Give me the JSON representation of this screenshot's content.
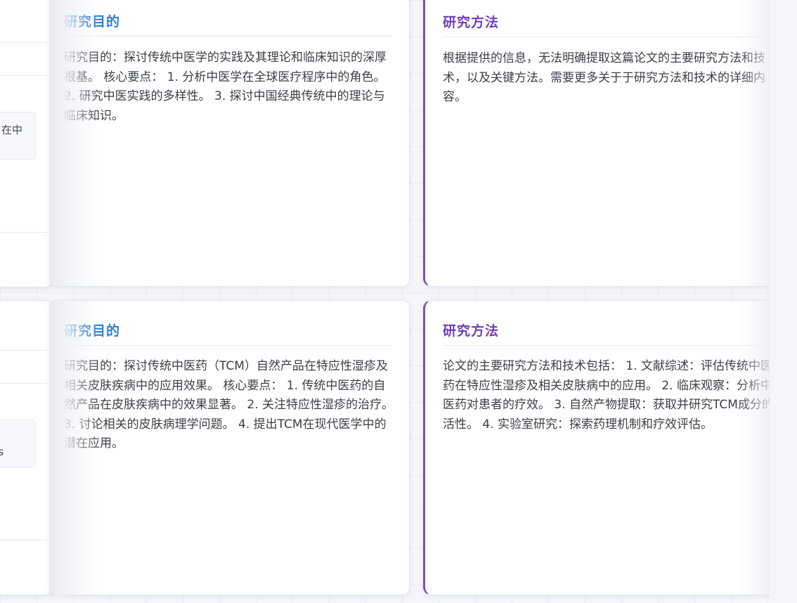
{
  "rows": [
    {
      "left_partial": {
        "chip_text": "在中"
      },
      "purpose": {
        "title": "研究目的",
        "body": "研究目的：探讨传统中医学的实践及其理论和临床知识的深厚根基。 核心要点： 1. 分析中医学在全球医疗程序中的角色。 2. 研究中医实践的多样性。 3. 探讨中国经典传统中的理论与临床知识。"
      },
      "method": {
        "title": "研究方法",
        "body": "根据提供的信息，无法明确提取这篇论文的主要研究方法和技术，以及关键方法。需要更多关于于研究方法和技术的详细内容。"
      }
    },
    {
      "left_partial": {
        "chip_text": "ers"
      },
      "purpose": {
        "title": "研究目的",
        "body": "研究目的：探讨传统中医药（TCM）自然产品在特应性湿疹及相关皮肤疾病中的应用效果。 核心要点： 1. 传统中医药的自然产品在皮肤疾病中的效果显著。 2. 关注特应性湿疹的治疗。 3. 讨论相关的皮肤病理学问题。 4. 提出TCM在现代医学中的潜在应用。"
      },
      "method": {
        "title": "研究方法",
        "body": "论文的主要研究方法和技术包括： 1. 文献综述：评估传统中医药在特应性湿疹及相关皮肤病中的应用。 2. 临床观察：分析中医药对患者的疗效。 3. 自然产物提取：获取并研究TCM成分的活性。 4. 实验室研究：探索药理机制和疗效评估。"
      }
    }
  ],
  "colors": {
    "purpose_title": "#2f7fd0",
    "method_title": "#6f3fb8",
    "method_accent_border": "#7b4fc4",
    "body_text": "#3b3f47"
  }
}
